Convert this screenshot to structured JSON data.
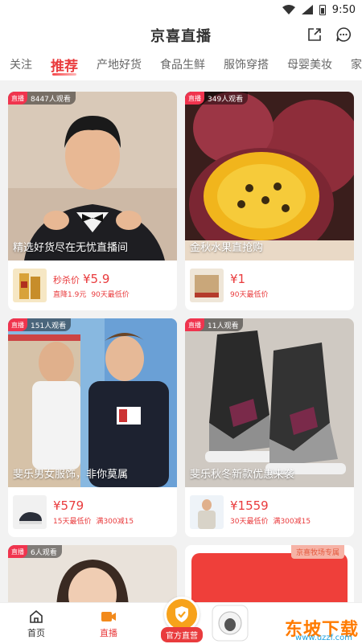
{
  "status_bar": {
    "time": "9:50"
  },
  "header": {
    "title": "京喜直播"
  },
  "tabs": [
    {
      "label": "关注"
    },
    {
      "label": "推荐"
    },
    {
      "label": "产地好货"
    },
    {
      "label": "食品生鲜"
    },
    {
      "label": "服饰穿搭"
    },
    {
      "label": "母婴美妆"
    },
    {
      "label": "家居日用"
    }
  ],
  "cards": [
    {
      "viewers": "8447人观看",
      "title": "精选好货尽在无忧直播间",
      "price_label": "秒杀价",
      "price": "¥5.9",
      "tag1": "直降1.9元",
      "tag2": "90天最低价"
    },
    {
      "viewers": "349人观看",
      "title": "金秋水果直抢购",
      "price_label": "",
      "price": "¥1",
      "tag1": "90天最低价",
      "tag2": ""
    },
    {
      "viewers": "151人观看",
      "title": "斐乐男女服饰，非你莫属",
      "price_label": "",
      "price": "¥579",
      "tag1": "15天最低价",
      "tag2": "满300减15"
    },
    {
      "viewers": "11人观看",
      "title": "斐乐秋冬新款优惠来袭",
      "price_label": "",
      "price": "¥1559",
      "tag1": "30天最低价",
      "tag2": "满300减15"
    },
    {
      "viewers": "6人观看"
    },
    {
      "promo": "京喜牧场专属"
    }
  ],
  "live_badge": "直播",
  "bottom_nav": {
    "home": "首页",
    "live": "直播",
    "official": "官方直营"
  },
  "watermark": {
    "main": "东坡下载",
    "sub": "www.uzzf.com"
  }
}
